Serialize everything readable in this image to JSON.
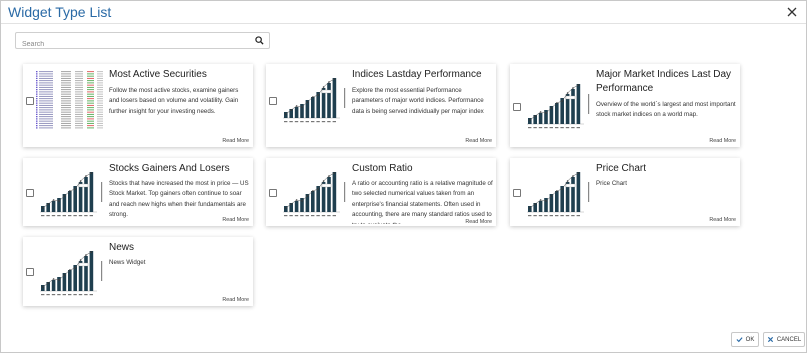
{
  "dialog": {
    "title": "Widget Type List",
    "close_icon": "close-icon"
  },
  "search": {
    "placeholder": "Search",
    "value": "",
    "icon": "search-icon"
  },
  "widgets": [
    {
      "title": "Most Active Securities",
      "description": "Follow the most active stocks, examine gainers and losers based on volume and volatility. Gain further insight for your investing needs.",
      "read_more": "Read More",
      "checked": false
    },
    {
      "title": "Indices Lastday Performance",
      "description": "Explore the most essential Performance parameters of major world indices. Performance data is being served individually per major index",
      "read_more": "Read More",
      "checked": false
    },
    {
      "title": "Major Market Indices Last Day Performance",
      "description": "Overview of the world`s largest and most important stock market indices on a world map.",
      "read_more": "Read More",
      "checked": false
    },
    {
      "title": "Stocks Gainers And Losers",
      "description": "Stocks that have increased the most in price — US Stock Market. Top gainers often continue to soar and reach new highs when their fundamentals are strong.",
      "read_more": "Read More",
      "checked": false
    },
    {
      "title": "Custom Ratio",
      "description": "A ratio or accounting ratio is a relative magnitude of two selected numerical values taken from an enterprise's financial statements. Often used in accounting, there are many standard ratios used to try to evaluate the",
      "read_more": "Read More",
      "checked": false
    },
    {
      "title": "Price Chart",
      "description": "Price Chart",
      "read_more": "Read More",
      "checked": false
    },
    {
      "title": "News",
      "description": "News Widget",
      "read_more": "Read More",
      "checked": false
    }
  ],
  "footer": {
    "ok_label": "OK",
    "cancel_label": "CANCEL",
    "ok_icon": "check-icon",
    "cancel_icon": "close-icon"
  },
  "colors": {
    "title": "#2a6aa6",
    "bar": "#1f3f4f",
    "button_icon": "#2a6aa6"
  }
}
